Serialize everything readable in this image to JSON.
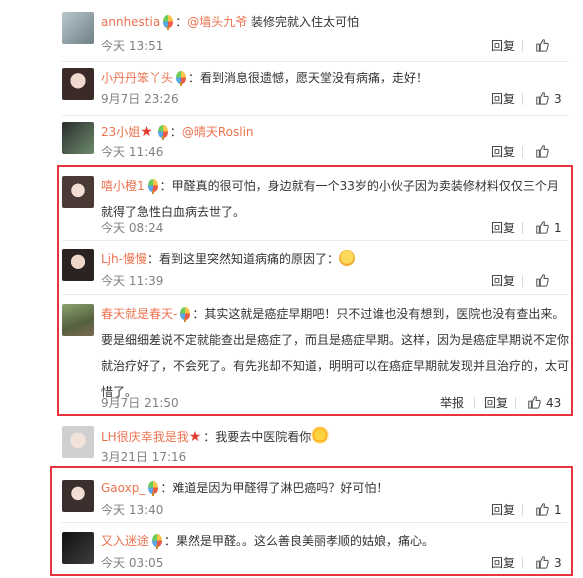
{
  "actions": {
    "reply": "回复",
    "report": "举报"
  },
  "colors": {
    "username": "#eb7350",
    "highlight_border": "#e5343d",
    "timestamp": "#808080"
  },
  "comments": [
    {
      "username": "annhestia",
      "mention": "@墙头九爷",
      "text": " 装修完就入住太可怕",
      "time": "今天 13:51",
      "likes": "",
      "badge": "colorful-balloon-icon"
    },
    {
      "username": "小丹丹笨丫头",
      "text": "：看到消息很遗憾，愿天堂没有病痛，走好！",
      "time": "9月7日 23:26",
      "likes": "3",
      "badge": "colorful-balloon-icon"
    },
    {
      "username": "23小姐",
      "mention": "@晴天Roslin",
      "text": "",
      "time": "今天 11:46",
      "likes": "",
      "badge": "colorful-balloon-icon"
    },
    {
      "username": "嘻小橙1",
      "text": "：甲醛真的很可怕，身边就有一个33岁的小伙子因为卖装修材料仅仅三个月就得了急性白血病去世了。",
      "time": "今天 08:24",
      "likes": "1",
      "badge": "colorful-balloon-icon"
    },
    {
      "username": "Ljh-慢慢",
      "text": "：看到这里突然知道病痛的原因了：",
      "time": "今天 11:39",
      "likes": "",
      "emoji": "angry-face-emoji"
    },
    {
      "username": "春天就是春天-",
      "text": "：其实这就是癌症早期吧！只不过谁也没有想到，医院也没有查出来。要是细细差说不定就能查出是癌症了，而且是癌症早期。这样，因为是癌症早期说不定你就治疗好了，不会死了。有先兆却不知道，明明可以在癌症早期就发现并且治疗的，太可惜了。",
      "time": "9月7日 21:50",
      "likes": "43",
      "badge": "colorful-balloon-icon"
    },
    {
      "username": "LH很庆幸我是我",
      "text": "：我要去中医院看你",
      "time": "3月21日 17:16",
      "likes": "",
      "emoji": "sun-face-emoji"
    },
    {
      "username": "Gaoxp_",
      "text": "：难道是因为甲醛得了淋巴癌吗？好可怕！",
      "time": "今天 13:40",
      "likes": "1",
      "badge": "colorful-balloon-icon"
    },
    {
      "username": "又入迷途",
      "text": "：果然是甲醛。。这么善良美丽孝顺的姑娘，痛心。",
      "time": "今天 03:05",
      "likes": "3",
      "badge": "colorful-balloon-icon"
    }
  ]
}
